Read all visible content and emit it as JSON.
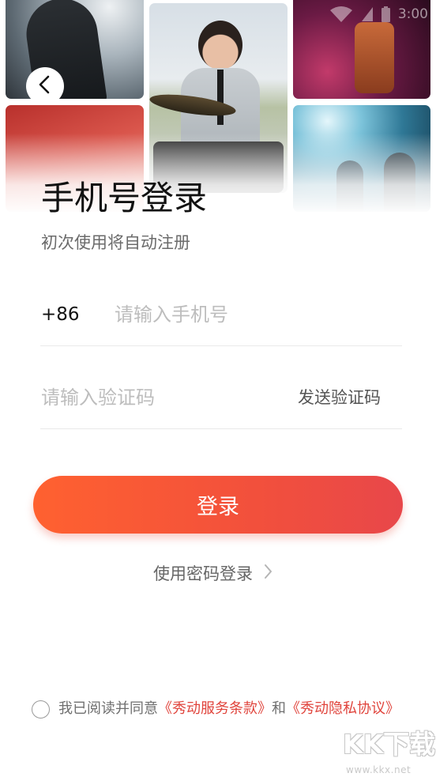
{
  "status_bar": {
    "wifi_icon": "wifi-icon",
    "signal_icon": "signal-icon",
    "battery_icon": "battery-icon",
    "time": "3:00"
  },
  "header": {
    "back_icon": "chevron-left-icon"
  },
  "title": "手机号登录",
  "subtitle": "初次使用将自动注册",
  "phone": {
    "country_code": "+86",
    "placeholder": "请输入手机号",
    "value": ""
  },
  "code": {
    "placeholder": "请输入验证码",
    "value": "",
    "send_label": "发送验证码"
  },
  "login_button": {
    "label": "登录"
  },
  "password_login": {
    "label": "使用密码登录",
    "icon": "chevron-right-icon"
  },
  "agreement": {
    "checked": false,
    "prefix": "我已阅读并同意",
    "terms": "《秀动服务条款》",
    "and": "和",
    "privacy": "《秀动隐私协议》"
  },
  "watermark": {
    "brand": "KK下载",
    "url": "www.kkx.net"
  },
  "colors": {
    "accent_start": "#ff6130",
    "accent_end": "#e8474a",
    "link": "#e0443c"
  }
}
